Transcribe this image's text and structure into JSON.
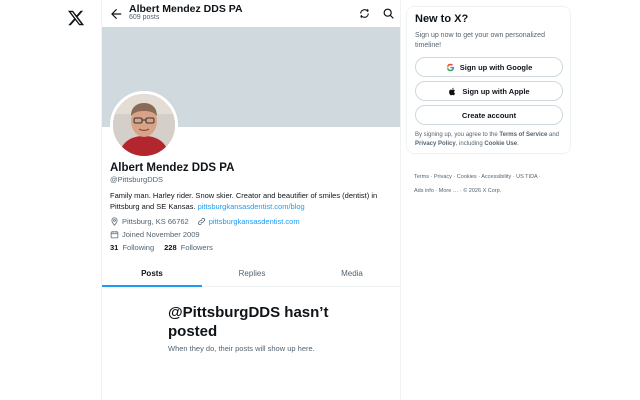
{
  "nav": {
    "logo_icon": "x-logo"
  },
  "header": {
    "name": "Albert Mendez DDS PA",
    "posts_count": "609 posts",
    "back_icon": "arrow-left-icon",
    "refresh_icon": "refresh-icon",
    "search_icon": "search-icon"
  },
  "profile": {
    "name": "Albert Mendez DDS PA",
    "handle": "@PittsburgDDS",
    "bio_text": "Family man. Harley rider. Snow skier. Creator and beautifier of smiles (dentist) in Pittsburg and SE Kansas.",
    "bio_link": "pittsburgkansasdentist.com/blog",
    "location": "Pittsburg, KS 66762",
    "website": "pittsburgkansasdentist.com",
    "joined": "Joined November 2009",
    "following_count": "31",
    "following_label": "Following",
    "followers_count": "228",
    "followers_label": "Followers"
  },
  "tabs": [
    {
      "label": "Posts",
      "active": true
    },
    {
      "label": "Replies",
      "active": false
    },
    {
      "label": "Media",
      "active": false
    }
  ],
  "empty_state": {
    "title": "@PittsburgDDS hasn’t posted",
    "subtitle": "When they do, their posts will show up here."
  },
  "signup": {
    "title": "New to X?",
    "subtitle": "Sign up now to get your own personalized timeline!",
    "google_label": "Sign up with Google",
    "apple_label": "Sign up with Apple",
    "create_label": "Create account",
    "terms_prefix": "By signing up, you agree to the",
    "terms_link": "Terms of Service",
    "terms_and": "and",
    "privacy_link": "Privacy Policy",
    "terms_including": ", including",
    "cookie_link": "Cookie Use",
    "terms_end": "."
  },
  "footer": {
    "line1": [
      "Terms",
      "Privacy",
      "Cookies",
      "Accessibility",
      "US TIDA"
    ],
    "line2": [
      "Ads info",
      "More …",
      "© 2026 X Corp."
    ]
  },
  "colors": {
    "accent": "#1d9bf0",
    "banner": "#cfd9de",
    "muted": "#536471"
  }
}
